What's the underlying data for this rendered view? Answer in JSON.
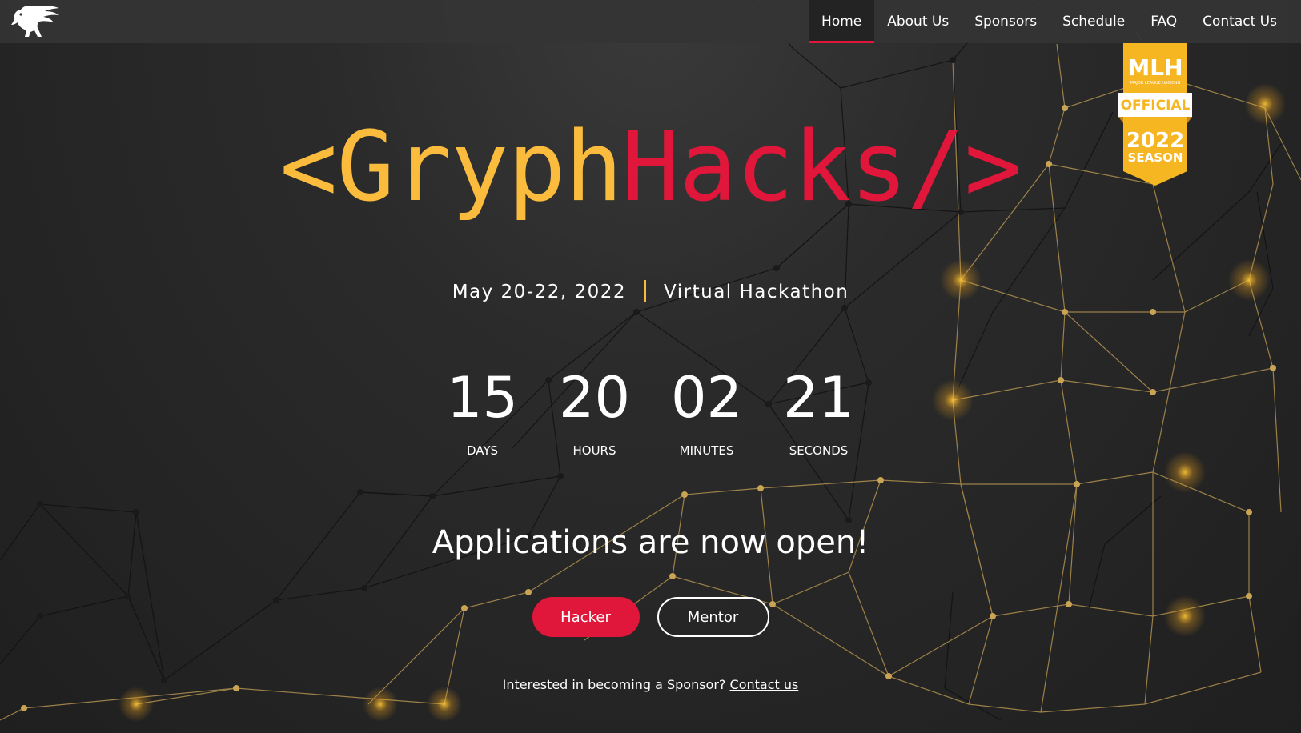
{
  "nav": {
    "items": [
      {
        "label": "Home",
        "active": true
      },
      {
        "label": "About Us",
        "active": false
      },
      {
        "label": "Sponsors",
        "active": false
      },
      {
        "label": "Schedule",
        "active": false
      },
      {
        "label": "FAQ",
        "active": false
      },
      {
        "label": "Contact Us",
        "active": false
      }
    ],
    "logo_icon": "gryphon-icon"
  },
  "badge": {
    "brand": "MLH",
    "subtitle": "MAJOR LEAGUE HACKING",
    "ribbon": "OFFICIAL",
    "year": "2022",
    "season": "SEASON"
  },
  "hero": {
    "title_part1": "<Gryph",
    "title_part2": "Hacks/>",
    "date": "May 20-22, 2022",
    "event_type": "Virtual Hackathon"
  },
  "countdown": {
    "days": "15",
    "days_label": "DAYS",
    "hours": "20",
    "hours_label": "HOURS",
    "minutes": "02",
    "minutes_label": "MINUTES",
    "seconds": "21",
    "seconds_label": "SECONDS"
  },
  "applications": {
    "headline": "Applications are now open!",
    "hacker_button": "Hacker",
    "mentor_button": "Mentor"
  },
  "sponsor": {
    "text": "Interested in becoming a Sponsor?",
    "link": "Contact us"
  },
  "colors": {
    "accent_yellow": "#fbbc3d",
    "accent_red": "#e0173a",
    "background": "#232323",
    "navbar": "#343434"
  }
}
